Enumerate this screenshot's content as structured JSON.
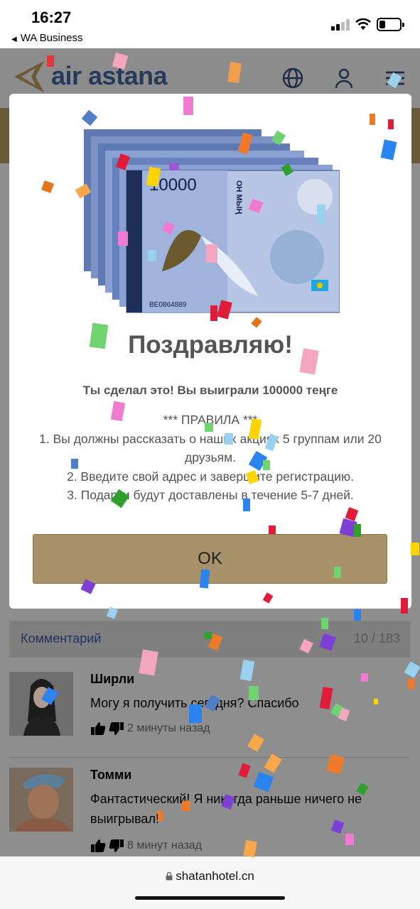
{
  "status_bar": {
    "time": "16:27",
    "back_app": "WA Business"
  },
  "header": {
    "logo_text": "air astana",
    "icons": [
      "globe-icon",
      "user-icon",
      "menu-icon"
    ]
  },
  "modal": {
    "title": "Поздравляю!",
    "subtitle": "Ты сделал это! Вы выиграли 100000 теңге",
    "rules_heading": "*** ПРАВИЛА ***",
    "rules": [
      "1. Вы должны рассказать о наших акциях 5 группам или 20 друзьям.",
      "2. Введите свой адрес и завершите регистрацию.",
      "3. Подарки будут доставлены в течение 5-7 дней."
    ],
    "ok_label": "OK",
    "banknote": {
      "denomination": "10000",
      "serial": "ВЕ0864889",
      "words": "ОН МЫҢ"
    }
  },
  "comments": {
    "label": "Комментарий",
    "count": "10 / 183",
    "items": [
      {
        "name": "Ширли",
        "text": "Могу я получить сегодня? Спасибо",
        "time": "2 минуты назад"
      },
      {
        "name": "Томми",
        "text": "Фантастический! Я никогда раньше ничего не выигрывал!",
        "time": "8 минут назад"
      }
    ]
  },
  "browser": {
    "url": "shatanhotel.cn"
  },
  "colors": {
    "button": "#a89069",
    "brand_navy": "#263a5c",
    "header_band": "#6a5a3c",
    "overlay": "#8e8e8e"
  }
}
